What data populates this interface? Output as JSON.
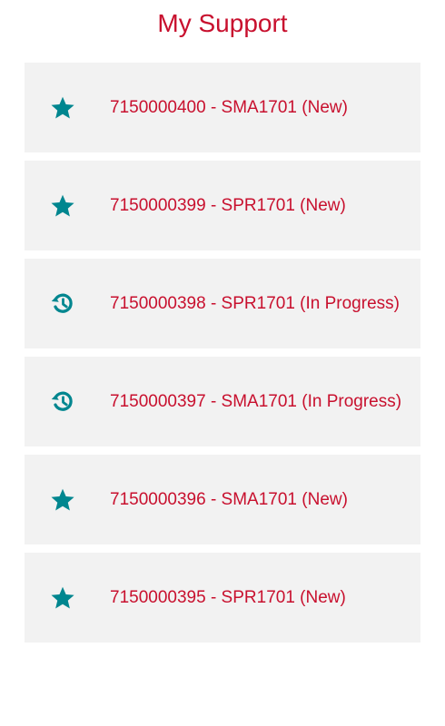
{
  "header": {
    "title": "My Support"
  },
  "colors": {
    "accent_text": "#c8102e",
    "icon": "#00868f",
    "row_background": "#f2f2f2"
  },
  "tickets": [
    {
      "label": "7150000400 - SMA1701 (New)",
      "status_icon": "star-icon"
    },
    {
      "label": "7150000399 - SPR1701 (New)",
      "status_icon": "star-icon"
    },
    {
      "label": "7150000398 - SPR1701 (In Progress)",
      "status_icon": "history-icon"
    },
    {
      "label": "7150000397 - SMA1701 (In Progress)",
      "status_icon": "history-icon"
    },
    {
      "label": "7150000396 - SMA1701 (New)",
      "status_icon": "star-icon"
    },
    {
      "label": "7150000395 - SPR1701 (New)",
      "status_icon": "star-icon"
    }
  ]
}
